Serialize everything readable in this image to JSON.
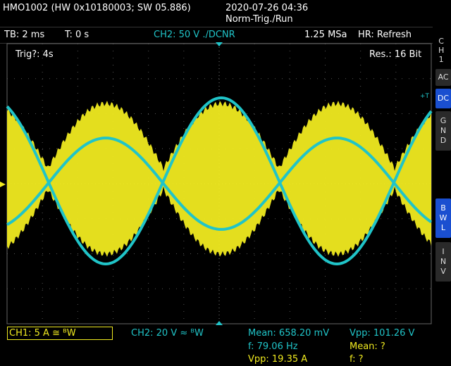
{
  "header": {
    "device": "HMO1002 (HW 0x10180003; SW 05.886)",
    "datetime": "2020-07-26 04:36",
    "mode": "Norm-Trig./Run"
  },
  "infobar": {
    "timebase": "TB: 2 ms",
    "trigger_time": "T: 0 s",
    "ch2_setting": "CH2: 50 V ./DCNR",
    "sample_rate": "1.25 MSa",
    "hr_mode": "HR: Refresh"
  },
  "screen": {
    "trig_status": "Trig?: 4s",
    "resolution": "Res.: 16 Bit",
    "trig_marker": "+T"
  },
  "side_panel": {
    "channel_label": [
      "C",
      "H",
      "1"
    ],
    "buttons": [
      {
        "label": [
          "AC"
        ],
        "active": false
      },
      {
        "label": [
          "DC"
        ],
        "active": true
      },
      {
        "label": [
          "G",
          "N",
          "D"
        ],
        "active": false
      },
      {
        "label": [
          "B",
          "W",
          "L"
        ],
        "active": true
      },
      {
        "label": [
          "I",
          "N",
          "V"
        ],
        "active": false
      }
    ]
  },
  "footer": {
    "ch1": "CH1: 5 A ≅ ᴮW",
    "ch2": "CH2: 20 V ≈ ᴮW",
    "meas_mean1": "Mean: 658.20 mV",
    "meas_f1": "f: 79.06 Hz",
    "meas_vpp1": "Vpp: 19.35 A",
    "meas_vpp2": "Vpp: 101.26 V",
    "meas_mean2": "Mean: ?",
    "meas_f2": "f: ?"
  },
  "colors": {
    "ch1": "#f0ea20",
    "ch2": "#20c4c8",
    "active_button": "#1a4fd0"
  }
}
